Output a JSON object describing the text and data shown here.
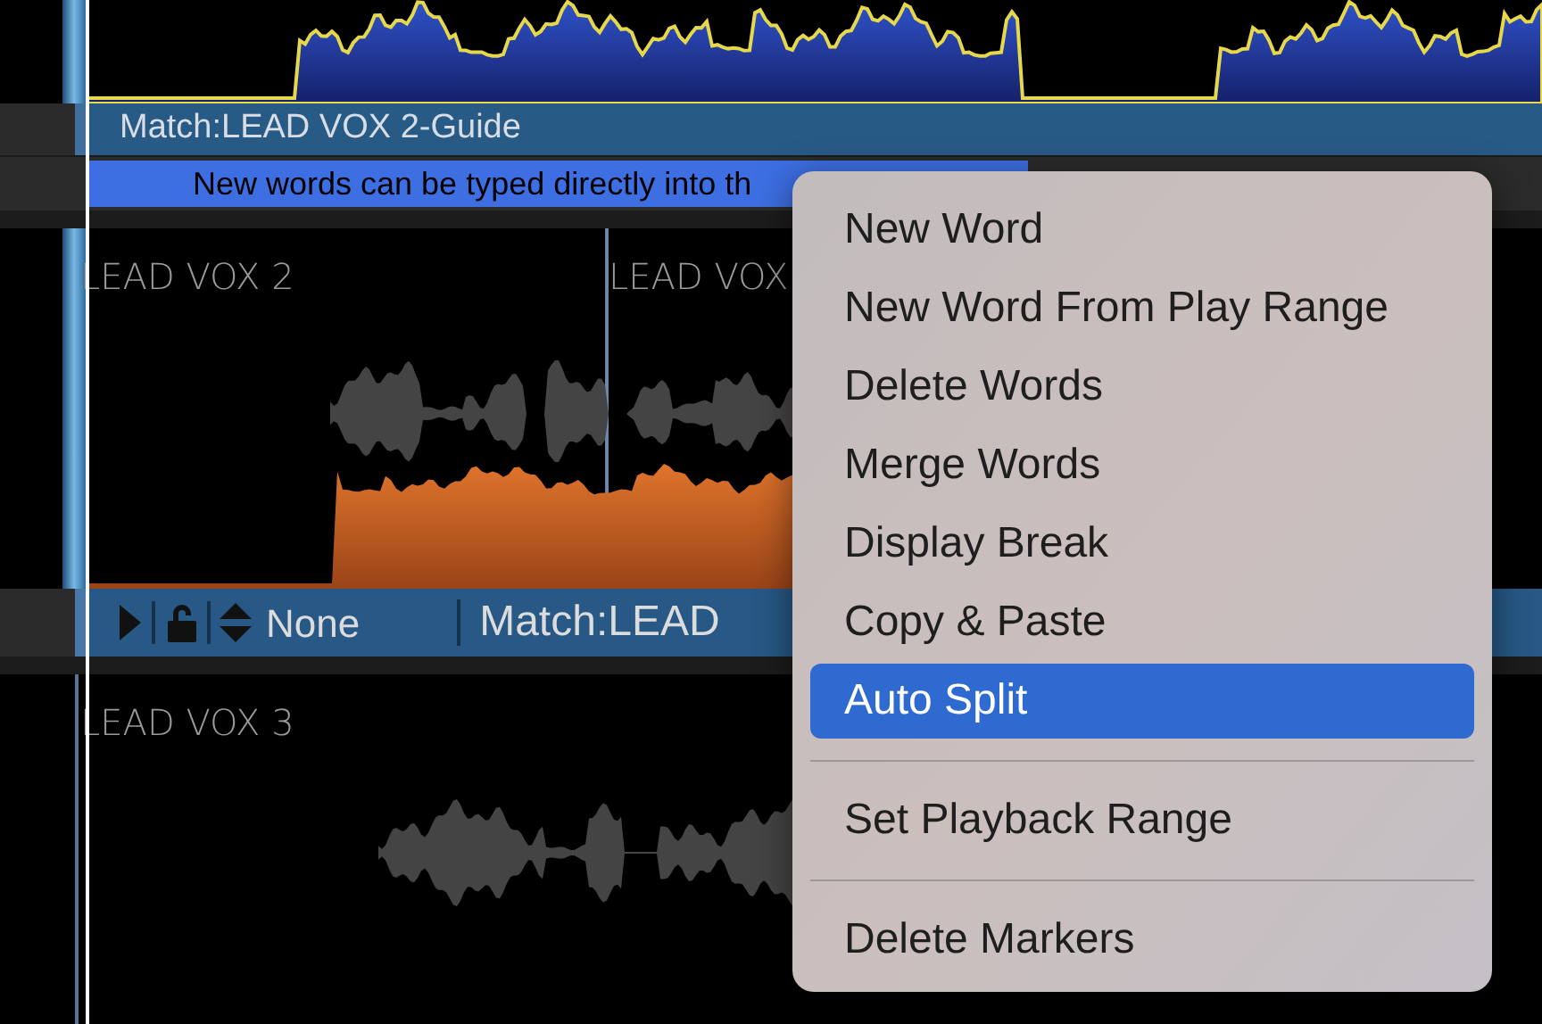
{
  "guide_track": {
    "title": "Match:LEAD VOX 2-Guide",
    "hint": "New words can be typed directly into th"
  },
  "track_2": {
    "labels": [
      "LEAD VOX 2",
      "LEAD VOX"
    ],
    "mode": "None",
    "match": "Match:LEAD"
  },
  "track_3": {
    "label": "LEAD VOX 3"
  },
  "context_menu": {
    "items": [
      {
        "kind": "item",
        "label": "New Word",
        "selected": false
      },
      {
        "kind": "item",
        "label": "New Word From Play Range",
        "selected": false
      },
      {
        "kind": "item",
        "label": "Delete Words",
        "selected": false
      },
      {
        "kind": "item",
        "label": "Merge Words",
        "selected": false
      },
      {
        "kind": "item",
        "label": "Display Break",
        "selected": false
      },
      {
        "kind": "item",
        "label": "Copy & Paste",
        "selected": false
      },
      {
        "kind": "item",
        "label": "Auto Split",
        "selected": true
      },
      {
        "kind": "separator"
      },
      {
        "kind": "item",
        "label": "Set Playback Range",
        "selected": false
      },
      {
        "kind": "separator"
      },
      {
        "kind": "item",
        "label": "Delete Markers",
        "selected": false
      }
    ]
  }
}
